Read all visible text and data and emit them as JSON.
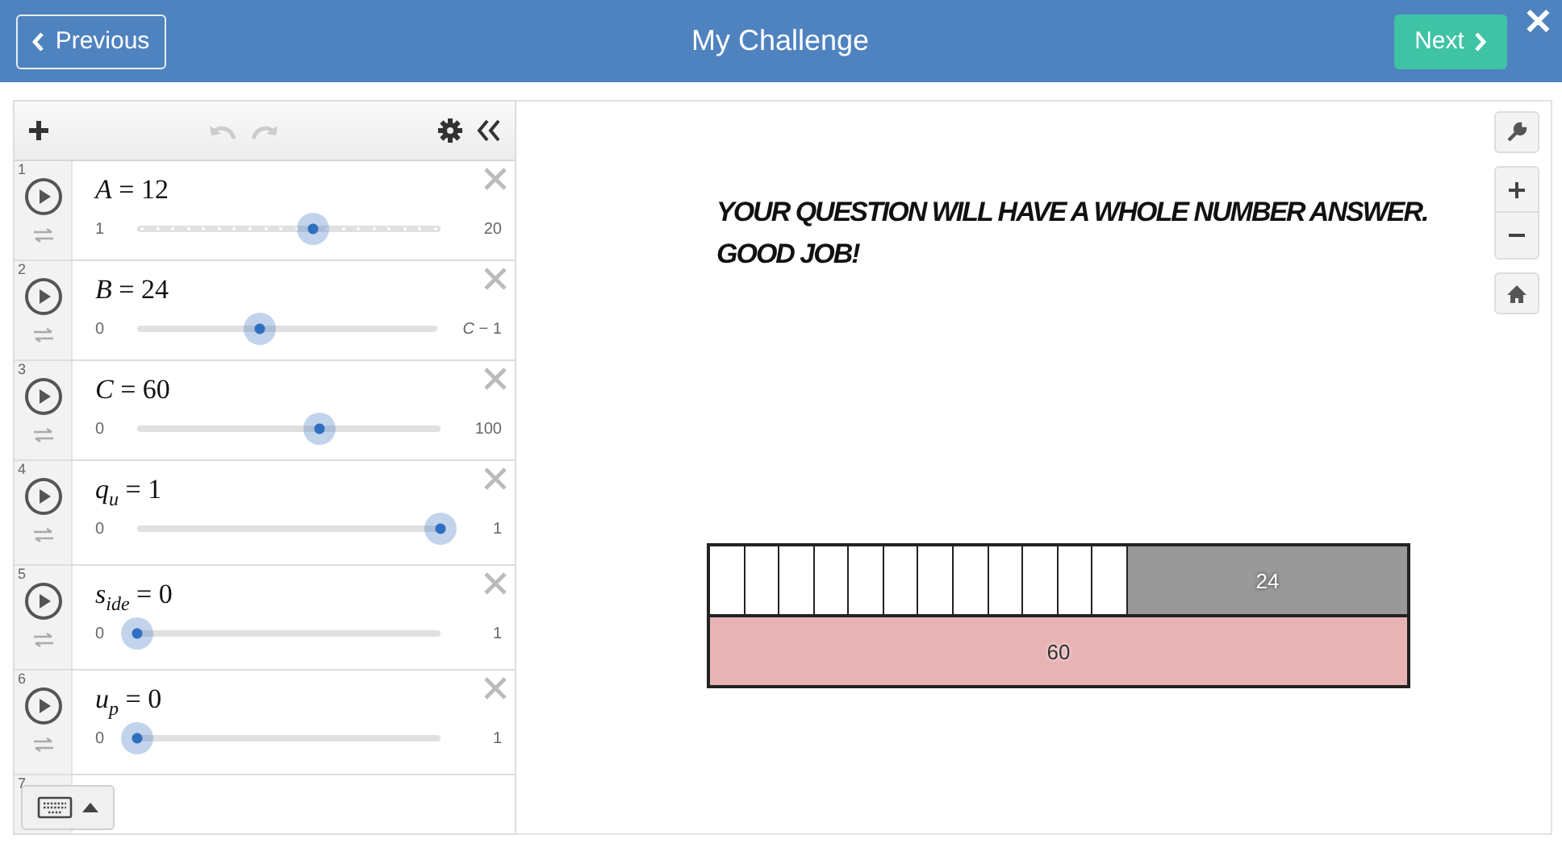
{
  "header": {
    "previous": "Previous",
    "title": "My Challenge",
    "next": "Next",
    "close": "✕"
  },
  "expressions": [
    {
      "number": "1",
      "formula": "*A* = 12",
      "min": "1",
      "max": "20",
      "level": 0.58,
      "stepped": true
    },
    {
      "number": "2",
      "formula": "*B* = 24",
      "min": "0",
      "max": "*C* − 1",
      "level": 0.41,
      "stepped": false
    },
    {
      "number": "3",
      "formula": "*C* = 60",
      "min": "0",
      "max": "100",
      "level": 0.6,
      "stepped": false
    },
    {
      "number": "4",
      "formula": "*q*$_{u}$ = 1",
      "min": "0",
      "max": "1",
      "level": 1,
      "stepped": false
    },
    {
      "number": "5",
      "formula": "*s*$_{ide}$ = 0",
      "min": "0",
      "max": "1",
      "level": 0,
      "stepped": false
    },
    {
      "number": "6",
      "formula": "*u*$_{p}$ = 0",
      "min": "0",
      "max": "1",
      "level": 0,
      "stepped": false
    }
  ],
  "empty_row": {
    "number": "7"
  },
  "message_lines": [
    "YOUR QUESTION WILL HAVE A WHOLE NUMBER ANSWER.",
    "GOOD JOB!"
  ],
  "bar_model": {
    "part_label": "24",
    "whole_label": "60"
  }
}
